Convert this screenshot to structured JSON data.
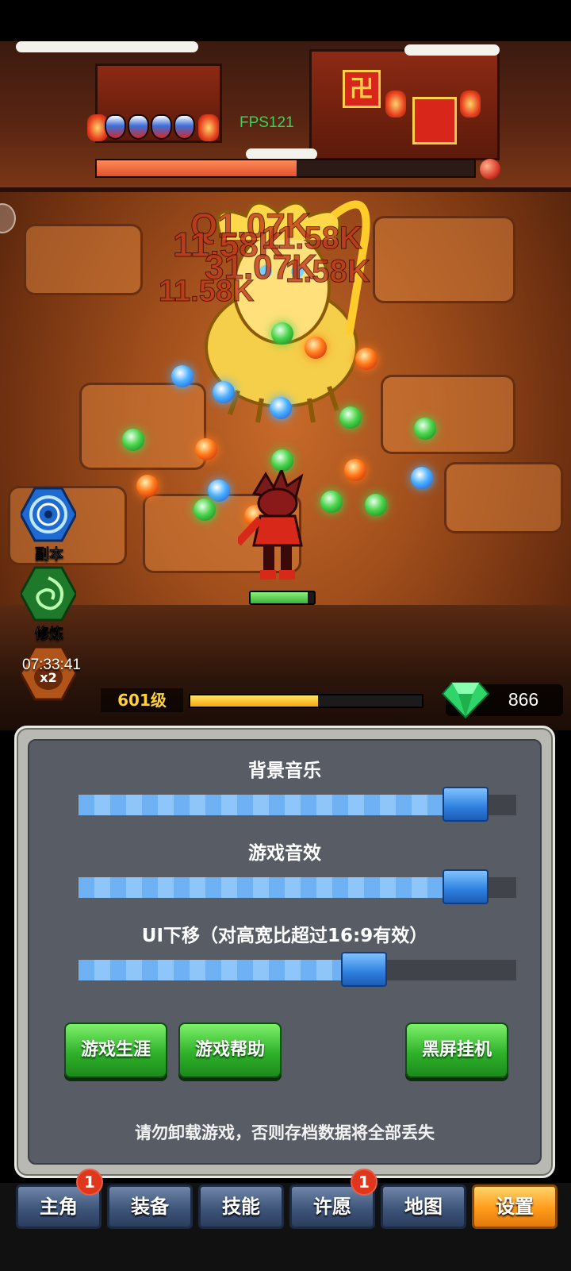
{
  "hud": {
    "fps": "FPS121",
    "boss_hp_fraction": 0.53,
    "hero_hp_fraction": 0.9,
    "damage_numbers": [
      "Q1.07K",
      "11.58K",
      "31.07K",
      "1.58K",
      "11.58K",
      "11.58K"
    ],
    "level": "601级",
    "xp_fraction": 0.55,
    "gems": "866",
    "timer": "07:33:41"
  },
  "side_menu": {
    "dungeon": "副本",
    "training": "修炼",
    "double_badge": "x2"
  },
  "settings": {
    "bgm_label": "背景音乐",
    "bgm_level": 0.93,
    "sfx_label": "游戏音效",
    "sfx_level": 0.93,
    "ui_shift_label": "UI下移（对高宽比超过16:9有效）",
    "ui_shift_level": 0.67,
    "career_button": "游戏生涯",
    "help_button": "游戏帮助",
    "blackscreen_button": "黑屏挂机",
    "warning": "请勿卸载游戏，否则存档数据将全部丢失"
  },
  "tabs": [
    {
      "label": "主角",
      "badge": "1"
    },
    {
      "label": "装备",
      "badge": ""
    },
    {
      "label": "技能",
      "badge": ""
    },
    {
      "label": "许愿",
      "badge": "1"
    },
    {
      "label": "地图",
      "badge": ""
    },
    {
      "label": "设置",
      "badge": "",
      "active": true
    }
  ],
  "colors": {
    "accent_orange": "#ff9a1a",
    "button_green": "#2fb22a",
    "slider_blue": "#6fb2f4",
    "level_yellow": "#ffd23a"
  }
}
